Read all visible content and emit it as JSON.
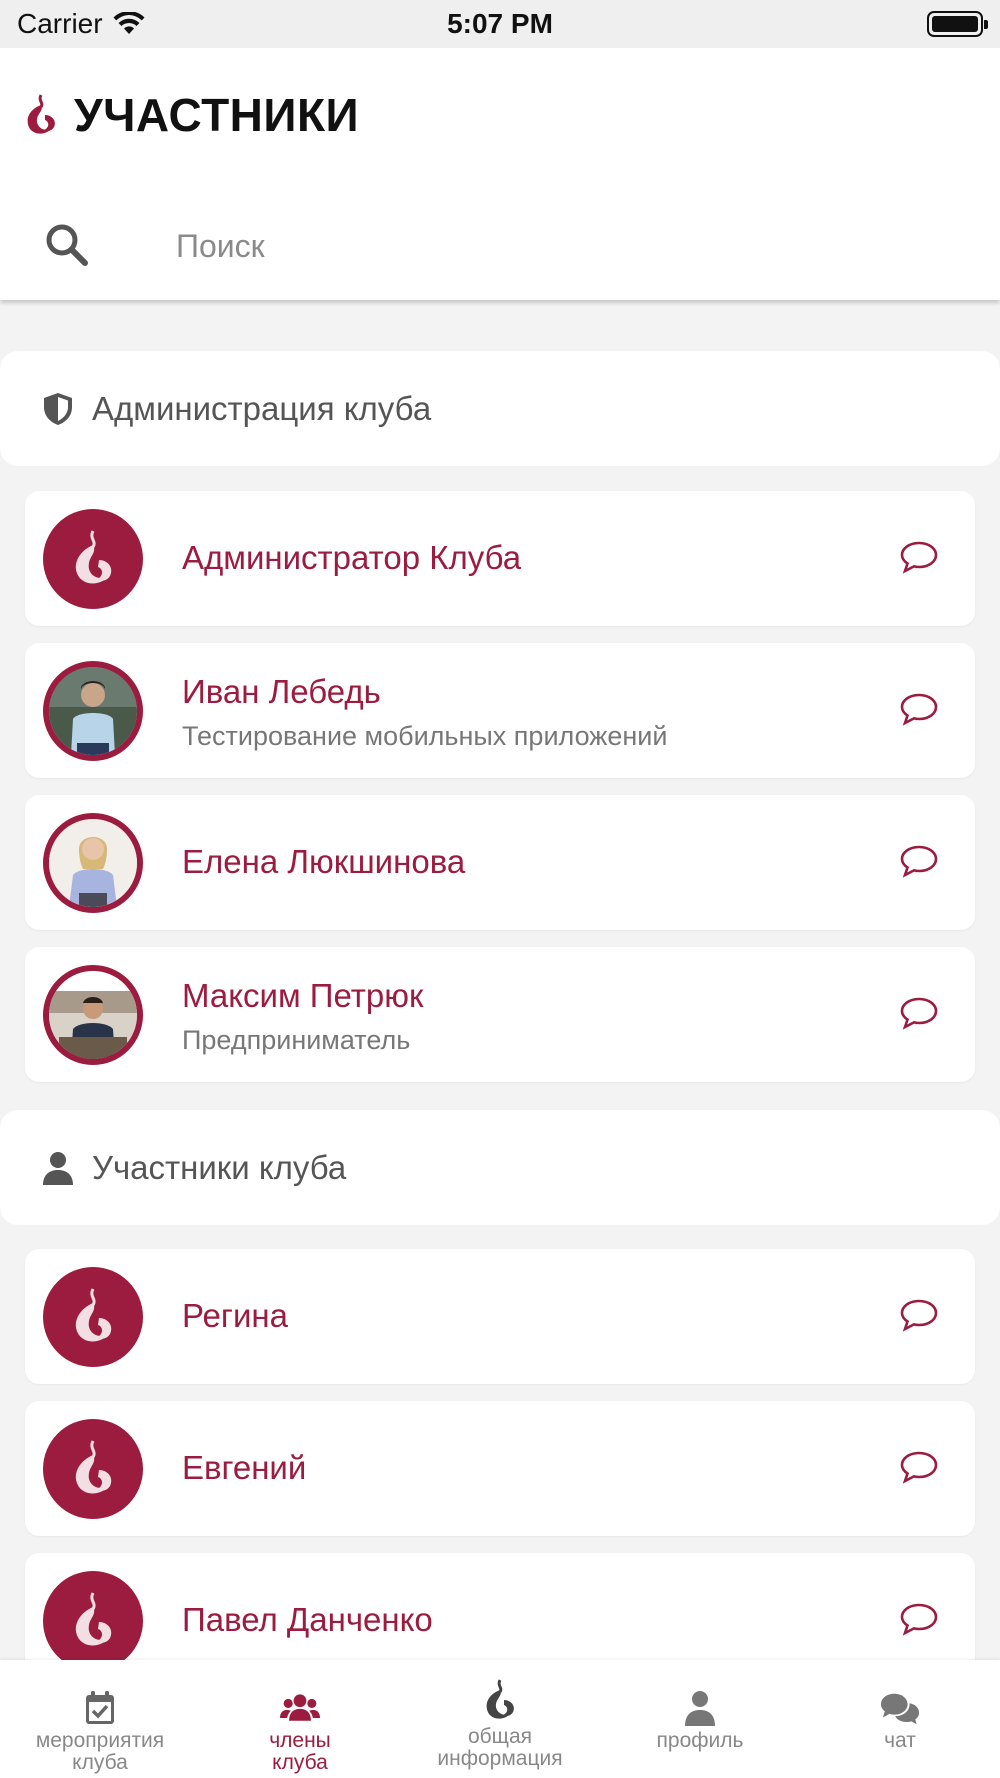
{
  "status_bar": {
    "carrier": "Carrier",
    "time": "5:07 PM"
  },
  "header": {
    "title": "УЧАСТНИКИ",
    "search_placeholder": "Поиск",
    "search_value": ""
  },
  "sections": [
    {
      "title": "Администрация клуба",
      "icon": "shield-icon",
      "members": [
        {
          "name": "Администратор Клуба",
          "subtitle": "",
          "avatar": "club-logo"
        },
        {
          "name": "Иван Лебедь",
          "subtitle": "Тестирование мобильных приложений",
          "avatar": "photo"
        },
        {
          "name": "Елена Люкшинова",
          "subtitle": "",
          "avatar": "photo"
        },
        {
          "name": "Максим Петрюк",
          "subtitle": "Предприниматель",
          "avatar": "photo"
        }
      ]
    },
    {
      "title": "Участники клуба",
      "icon": "person-icon",
      "members": [
        {
          "name": "Регина",
          "subtitle": "",
          "avatar": "club-logo"
        },
        {
          "name": "Евгений",
          "subtitle": "",
          "avatar": "club-logo"
        },
        {
          "name": "Павел Данченко",
          "subtitle": "",
          "avatar": "club-logo"
        }
      ]
    }
  ],
  "tabs": [
    {
      "label": "мероприятия\nклуба",
      "icon": "calendar-check-icon",
      "active": false
    },
    {
      "label": "члены\nклуба",
      "icon": "users-icon",
      "active": true
    },
    {
      "label": "общая\nинформация",
      "icon": "club-logo-icon",
      "active": false
    },
    {
      "label": "профиль",
      "icon": "person-icon",
      "active": false
    },
    {
      "label": "чат",
      "icon": "chat-bubbles-icon",
      "active": false
    }
  ],
  "colors": {
    "accent": "#9b1c3f",
    "background": "#f3f3f3",
    "inactive": "#888888"
  }
}
